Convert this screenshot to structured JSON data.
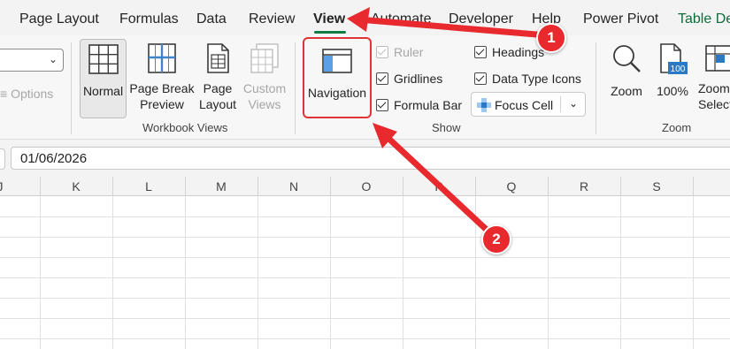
{
  "tabs": [
    {
      "label": "Page Layout"
    },
    {
      "label": "Formulas"
    },
    {
      "label": "Data"
    },
    {
      "label": "Review"
    },
    {
      "label": "View"
    },
    {
      "label": "Automate"
    },
    {
      "label": "Developer"
    },
    {
      "label": "Help"
    },
    {
      "label": "Power Pivot"
    },
    {
      "label": "Table De"
    }
  ],
  "ribbon": {
    "sheet_view_options": "Options",
    "workbook_views": {
      "label": "Workbook Views",
      "normal": "Normal",
      "page_break_preview": [
        "Page Break",
        "Preview"
      ],
      "page_layout": [
        "Page",
        "Layout"
      ],
      "custom_views": [
        "Custom",
        "Views"
      ]
    },
    "show": {
      "label": "Show",
      "navigation": "Navigation",
      "ruler": "Ruler",
      "gridlines": "Gridlines",
      "formula_bar": "Formula Bar",
      "headings": "Headings",
      "data_type_icons": "Data Type Icons",
      "focus_cell": "Focus Cell"
    },
    "zoom": {
      "label": "Zoom",
      "zoom": "Zoom",
      "hundred": "100%",
      "zoom_to_selection": [
        "Zoom",
        "Select"
      ]
    }
  },
  "formula_bar": {
    "value": "01/06/2026"
  },
  "columns": [
    "J",
    "K",
    "L",
    "M",
    "N",
    "O",
    "P",
    "Q",
    "R",
    "S"
  ],
  "annotations": {
    "badge1": "1",
    "badge2": "2"
  },
  "colors": {
    "accent_green": "#107c41",
    "annotation_red": "#e8292d"
  }
}
